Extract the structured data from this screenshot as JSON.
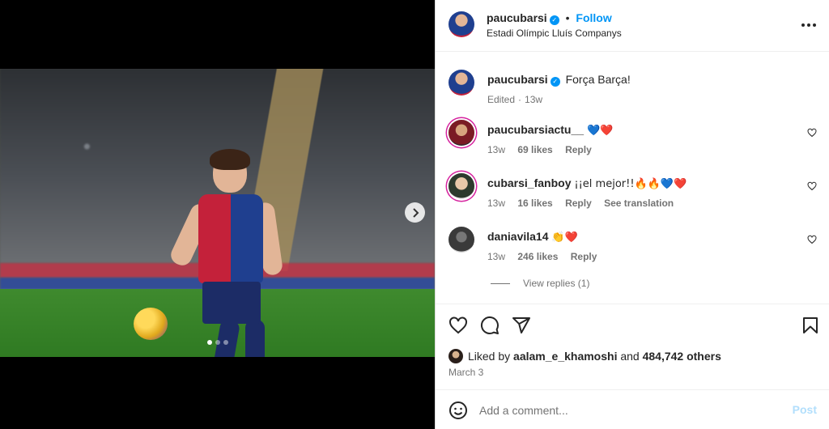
{
  "post": {
    "carousel": {
      "slide_count": 3,
      "active_slide": 1
    },
    "header": {
      "username": "paucubarsi",
      "separator": "•",
      "follow_label": "Follow",
      "location": "Estadi Olímpic Lluís Companys"
    },
    "caption": {
      "username": "paucubarsi",
      "text": "Força Barça!",
      "edited": "Edited",
      "time": "13w"
    },
    "comments": [
      {
        "username": "paucubarsiactu__",
        "text": "💙❤️",
        "time": "13w",
        "likes": "69 likes",
        "reply": "Reply"
      },
      {
        "username": "cubarsi_fanboy",
        "text": "¡¡el mejor!!🔥🔥💙❤️",
        "time": "13w",
        "likes": "16 likes",
        "reply": "Reply",
        "translate": "See translation"
      },
      {
        "username": "daniavila14",
        "text": "👏❤️",
        "time": "13w",
        "likes": "246 likes",
        "reply": "Reply"
      }
    ],
    "view_replies": "View replies (1)",
    "likes": {
      "prefix": "Liked by",
      "user": "aalam_e_khamoshi",
      "and": "and",
      "others": "484,742 others"
    },
    "date": "March 3",
    "add_comment": {
      "placeholder": "Add a comment...",
      "post_label": "Post"
    }
  },
  "colors": {
    "accent": "#0095f6",
    "post_disabled": "#b2dffc",
    "muted": "#737373"
  },
  "icons": [
    "verified-badge-icon",
    "more-options-icon",
    "heart-icon",
    "comment-icon",
    "share-icon",
    "bookmark-icon",
    "emoji-icon",
    "chevron-right-icon"
  ]
}
